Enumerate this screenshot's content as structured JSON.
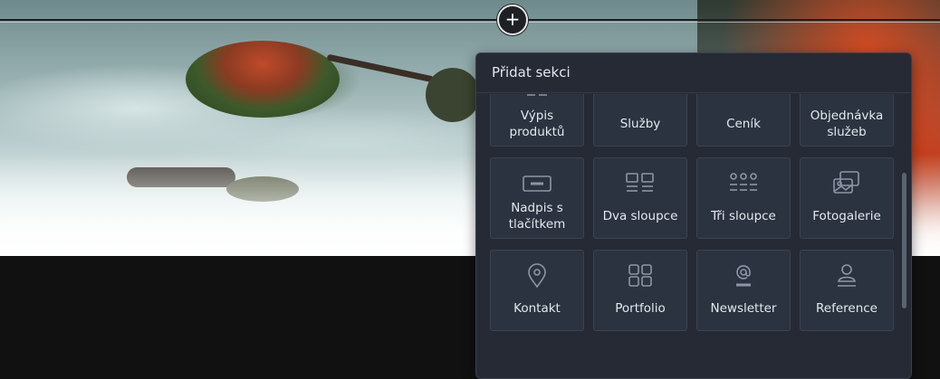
{
  "add_button": {
    "label": "+"
  },
  "panel": {
    "title": "Přidat sekci",
    "tiles": [
      {
        "label": "Výpis produktů",
        "icon": "product-list-icon"
      },
      {
        "label": "Služby",
        "icon": "services-icon"
      },
      {
        "label": "Ceník",
        "icon": "pricelist-icon"
      },
      {
        "label": "Objednávka služeb",
        "icon": "service-order-icon"
      },
      {
        "label": "Nadpis s tlačítkem",
        "icon": "heading-button-icon"
      },
      {
        "label": "Dva sloupce",
        "icon": "two-columns-icon"
      },
      {
        "label": "Tři sloupce",
        "icon": "three-columns-icon"
      },
      {
        "label": "Fotogalerie",
        "icon": "photo-gallery-icon"
      },
      {
        "label": "Kontakt",
        "icon": "location-pin-icon"
      },
      {
        "label": "Portfolio",
        "icon": "portfolio-grid-icon"
      },
      {
        "label": "Newsletter",
        "icon": "at-sign-icon"
      },
      {
        "label": "Reference",
        "icon": "person-icon"
      }
    ]
  }
}
